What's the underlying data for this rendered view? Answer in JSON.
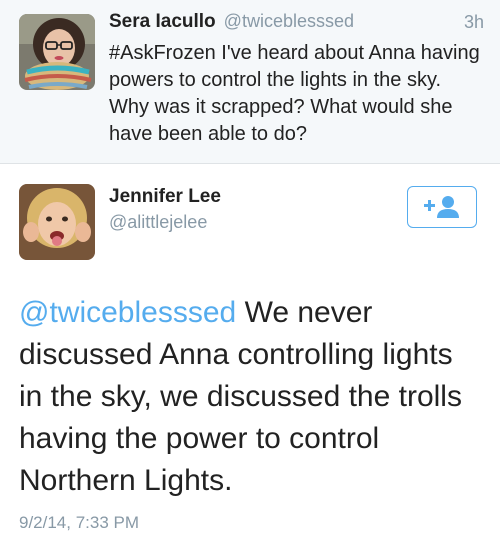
{
  "reply_tweet": {
    "author_name": "Sera Iacullo",
    "author_handle": "@twiceblesssed",
    "time": "3h",
    "text": "#AskFrozen I've heard about Anna having powers to control the lights in the sky. Why was it scrapped? What would she have been able to do?"
  },
  "main_tweet": {
    "author_name": "Jennifer Lee",
    "author_handle": "@alittlejelee",
    "mention": "@twiceblesssed",
    "text": "We never discussed Anna controlling lights in the sky, we discussed the trolls having the power to control Northern Lights.",
    "date": "9/2/14, 7:33 PM"
  },
  "icons": {
    "follow": "add-user-icon"
  },
  "colors": {
    "link_blue": "#55acee",
    "meta_gray": "#8899a6",
    "text": "#222222",
    "quoted_bg": "#f5f8fa"
  }
}
